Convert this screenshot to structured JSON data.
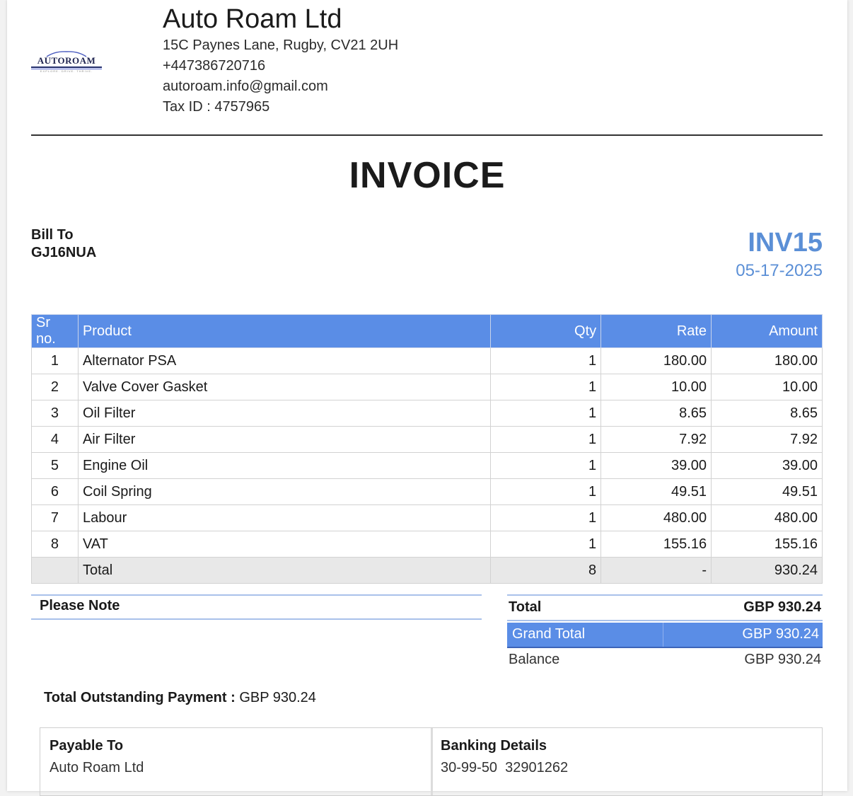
{
  "company": {
    "name": "Auto Roam Ltd",
    "address": "15C Paynes Lane, Rugby, CV21 2UH",
    "phone": "+447386720716",
    "email": "autoroam.info@gmail.com",
    "tax_id": "Tax ID : 4757965",
    "logo_text": "AUTOROAM",
    "logo_tagline": "EXPLORE. DRIVE. THRIVE."
  },
  "title": "INVOICE",
  "bill_to": {
    "label": "Bill To",
    "value": "GJ16NUA"
  },
  "invoice": {
    "number": "INV15",
    "date": "05-17-2025"
  },
  "table": {
    "headers": {
      "sr": "Sr no.",
      "product": "Product",
      "qty": "Qty",
      "rate": "Rate",
      "amount": "Amount"
    },
    "rows": [
      {
        "sr": "1",
        "product": "Alternator PSA",
        "qty": "1",
        "rate": "180.00",
        "amount": "180.00"
      },
      {
        "sr": "2",
        "product": "Valve Cover Gasket",
        "qty": "1",
        "rate": "10.00",
        "amount": "10.00"
      },
      {
        "sr": "3",
        "product": "Oil Filter",
        "qty": "1",
        "rate": "8.65",
        "amount": "8.65"
      },
      {
        "sr": "4",
        "product": "Air Filter",
        "qty": "1",
        "rate": "7.92",
        "amount": "7.92"
      },
      {
        "sr": "5",
        "product": "Engine Oil",
        "qty": "1",
        "rate": "39.00",
        "amount": "39.00"
      },
      {
        "sr": "6",
        "product": "Coil Spring",
        "qty": "1",
        "rate": "49.51",
        "amount": "49.51"
      },
      {
        "sr": "7",
        "product": "Labour",
        "qty": "1",
        "rate": "480.00",
        "amount": "480.00"
      },
      {
        "sr": "8",
        "product": "VAT",
        "qty": "1",
        "rate": "155.16",
        "amount": "155.16"
      }
    ],
    "total": {
      "label": "Total",
      "qty": "8",
      "rate": "-",
      "amount": "930.24"
    }
  },
  "note": {
    "label": "Please Note"
  },
  "summary": {
    "total_label": "Total",
    "total_value": "GBP 930.24",
    "grand_total_label": "Grand Total",
    "grand_total_value": "GBP 930.24",
    "balance_label": "Balance",
    "balance_value": "GBP 930.24"
  },
  "outstanding": {
    "label": "Total Outstanding Payment :",
    "value": "GBP 930.24"
  },
  "payable": {
    "payable_label": "Payable To",
    "payable_value": "Auto Roam Ltd",
    "banking_label": "Banking Details",
    "banking_value": "30-99-50  32901262"
  },
  "colors": {
    "accent": "#5a8de6",
    "invoice_number": "#5b8fd6",
    "total_row_bg": "#e8e8e8"
  }
}
